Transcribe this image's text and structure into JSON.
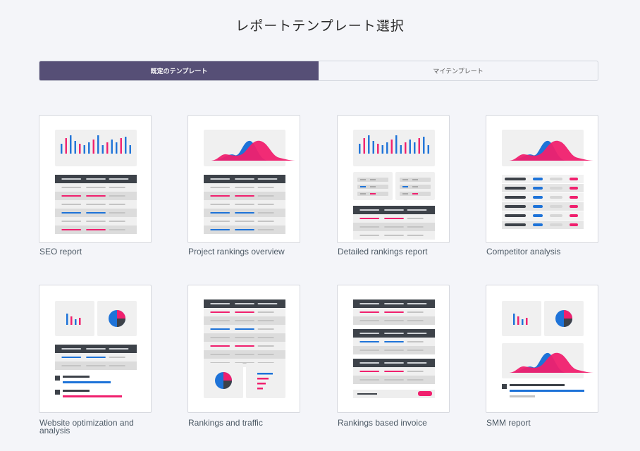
{
  "page": {
    "title": "レポートテンプレート選択"
  },
  "tabs": [
    {
      "label": "既定のテンプレート",
      "active": true
    },
    {
      "label": "マイテンプレート",
      "active": false
    }
  ],
  "templates": [
    {
      "name": "SEO report",
      "preview": "seo"
    },
    {
      "name": "Project rankings overview",
      "preview": "project-rankings"
    },
    {
      "name": "Detailed rankings report",
      "preview": "detailed-rankings"
    },
    {
      "name": "Competitor analysis",
      "preview": "competitor"
    },
    {
      "name": "Website optimization and analysis",
      "preview": "website-optimization"
    },
    {
      "name": "Rankings and traffic",
      "preview": "rankings-traffic"
    },
    {
      "name": "Rankings based invoice",
      "preview": "invoice"
    },
    {
      "name": "SMM report",
      "preview": "smm"
    }
  ],
  "colors": {
    "accent": "#564f76",
    "pink": "#f0206e",
    "blue": "#1e73d8",
    "dark": "#3d4249",
    "gray": "#d3d3d3",
    "panel": "#f0f0f0"
  }
}
